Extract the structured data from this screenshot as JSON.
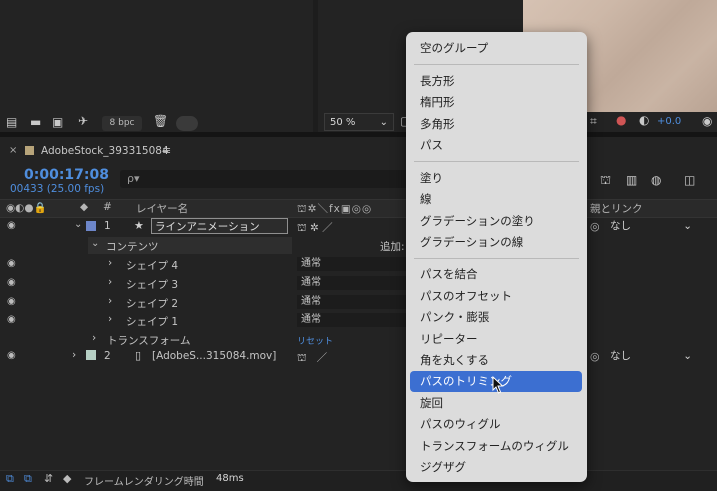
{
  "top_left_toolbar": {
    "bpc_label": "8 bpc"
  },
  "viewer_toolbar": {
    "zoom": "50 %",
    "exposure_value": "+0.0"
  },
  "timeline": {
    "comp_name": "AdobeStock_393315084",
    "timecode": "0:00:17:08",
    "frames_fps": "00433 (25.00 fps)",
    "search_glyph": "ρ▾",
    "columns": {
      "number": "#",
      "layer_name": "レイヤー名",
      "parent_link": "親とリンク"
    },
    "layer1": {
      "index": "1",
      "name": "ラインアニメーション",
      "parent": "なし"
    },
    "contents_label": "コンテンツ",
    "add_label": "追加:",
    "shapes": [
      {
        "name": "シェイプ 4",
        "mode": "通常"
      },
      {
        "name": "シェイプ 3",
        "mode": "通常"
      },
      {
        "name": "シェイプ 2",
        "mode": "通常"
      },
      {
        "name": "シェイプ 1",
        "mode": "通常"
      }
    ],
    "transform_label": "トランスフォーム",
    "reset_label": "リセット",
    "layer2": {
      "index": "2",
      "name": "[AdobeS...315084.mov]",
      "parent": "なし"
    },
    "footer": {
      "label": "フレームレンダリング時間",
      "ms": "48ms"
    }
  },
  "add_menu": {
    "items": [
      "空のグループ",
      "長方形",
      "楕円形",
      "多角形",
      "パス",
      "塗り",
      "線",
      "グラデーションの塗り",
      "グラデーションの線",
      "パスを結合",
      "パスのオフセット",
      "パンク・膨張",
      "リピーター",
      "角を丸くする",
      "パスのトリミング",
      "旋回",
      "パスのウィグル",
      "トランスフォームのウィグル",
      "ジグザグ"
    ],
    "highlighted": "パスのトリミング"
  },
  "colors": {
    "accent_blue": "#4f8ede",
    "menu_highlight": "#3c6fd1",
    "layer1_label": "#6d86c9",
    "layer2_label": "#b6cfc4"
  }
}
